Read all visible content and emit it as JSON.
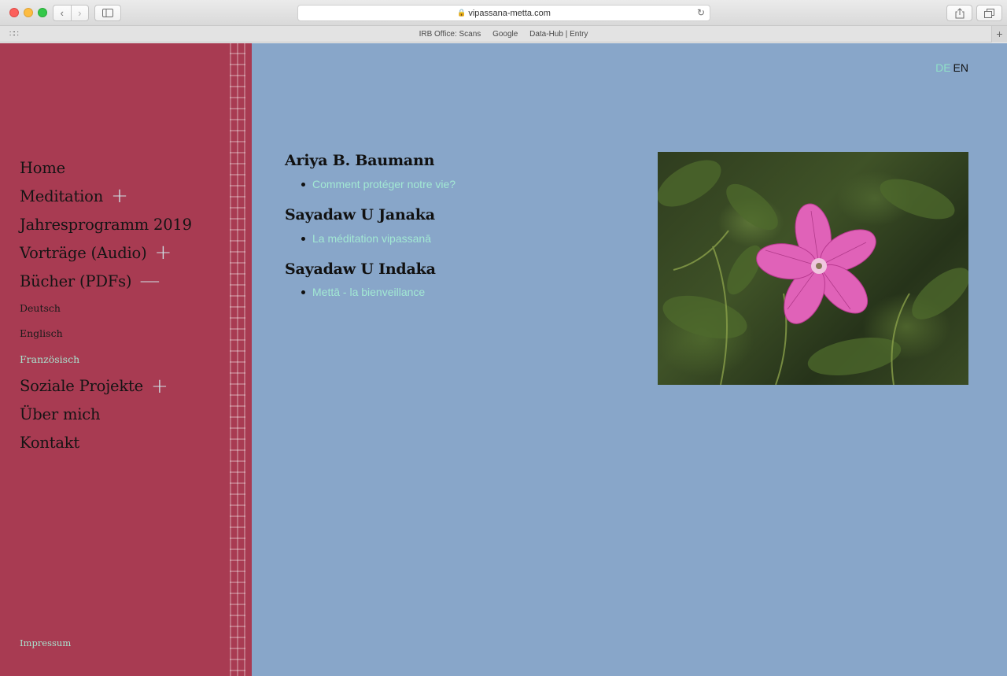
{
  "browser": {
    "url": "vipassana-metta.com",
    "back_icon": "chevron-left-icon",
    "forward_icon": "chevron-right-icon",
    "bookmarks": [
      "IRB Office: Scans",
      "Google",
      "Data-Hub | Entry"
    ]
  },
  "language": {
    "de": "DE",
    "en": "EN",
    "active": "DE"
  },
  "nav": {
    "items": [
      {
        "label": "Home",
        "toggle": ""
      },
      {
        "label": "Meditation",
        "toggle": "+"
      },
      {
        "label": "Jahresprogramm 2019",
        "toggle": ""
      },
      {
        "label": "Vorträge (Audio)",
        "toggle": "+"
      },
      {
        "label": "Bücher (PDFs)",
        "toggle": "—"
      }
    ],
    "sub_items": [
      {
        "label": "Deutsch"
      },
      {
        "label": "Englisch"
      },
      {
        "label": "Französisch",
        "active": true
      }
    ],
    "items_after": [
      {
        "label": "Soziale Projekte",
        "toggle": "+"
      },
      {
        "label": "Über mich",
        "toggle": ""
      },
      {
        "label": "Kontakt",
        "toggle": ""
      }
    ],
    "impressum": "Impressum"
  },
  "content": {
    "sections": [
      {
        "author": "Ariya B. Baumann",
        "books": [
          "Comment protéger notre vie?"
        ]
      },
      {
        "author": "Sayadaw U Janaka",
        "books": [
          "La méditation vipassanā"
        ]
      },
      {
        "author": "Sayadaw U Indaka",
        "books": [
          "Mettā - la bienveillance"
        ]
      }
    ]
  },
  "colors": {
    "sidebar_bg": "#a83b52",
    "main_bg": "#88a6c9",
    "link": "#a2e8d3",
    "active_lang": "#8fe0c7"
  }
}
